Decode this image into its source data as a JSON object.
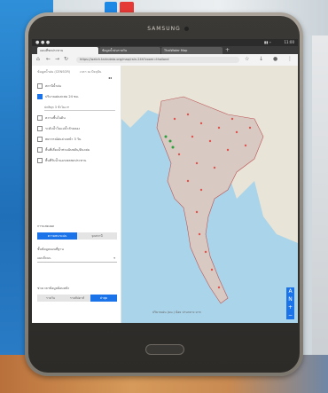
{
  "device": {
    "brand": "SAMSUNG"
  },
  "browser": {
    "tabs": [
      {
        "label": "แผนที่ชลประทาน"
      },
      {
        "label": "ข้อมูลน้ำฝนรายวัน"
      },
      {
        "label": "ThaiWater Map"
      }
    ],
    "url": "https://watch.tarindata.org/map/rain-24h?zoom=thailand"
  },
  "statusbar": {
    "time": "11:00"
  },
  "panel": {
    "header_left": "ข้อมูลน้ำฝน (CENSOR)",
    "header_right": "เวลา ณ ปัจจุบัน",
    "layers": [
      {
        "label": "สถานีน้ำฝน",
        "checked": false
      },
      {
        "label": "ปริมาณฝนสะสม 24 ชม.",
        "checked": true
      },
      {
        "label": "ความชื้นในดิน",
        "checked": false
      },
      {
        "label": "ระดับน้ำในแม่น้ำลำคลอง",
        "checked": false
      },
      {
        "label": "พยากรณ์ฝนล่วงหน้า 3 วัน",
        "checked": false
      },
      {
        "label": "พื้นที่เสี่ยงน้ำท่วมฉับพลัน/ดินถล่ม",
        "checked": false
      },
      {
        "label": "พื้นที่รับน้ำนอกเขตชลประทาน",
        "checked": false
      }
    ],
    "sub_select": "ปกติทุก 3 ชั่วโมง",
    "display_label": "การแสดงผล",
    "toggle": [
      "ความหนาแน่น",
      "จุดสถานี"
    ],
    "basemap_label": "ชั้นข้อมูลแผนที่ฐาน",
    "basemap_value": "แผนที่ถนน",
    "period_label": "ช่วงเวลาข้อมูลย้อนหลัง",
    "segments": [
      "รายวัน",
      "รายสัปดาห์",
      "ล่าสุด"
    ]
  },
  "map": {
    "legend_label": "ปริมาณฝน (มม.) น้อย ปานกลาง มาก",
    "legend_colors": [
      "#2e9e3e",
      "#f2e63a",
      "#f19a2a",
      "#d8332a"
    ],
    "controls": [
      "A",
      "N",
      "+",
      "−"
    ]
  }
}
